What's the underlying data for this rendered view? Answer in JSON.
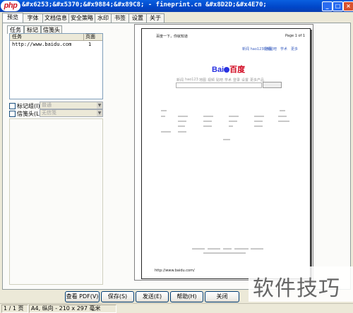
{
  "window": {
    "title": "&#x6253;&#x5370;&#x9884;&#x89C8; - fineprint.cn &#x8D2D;&#x4E70;",
    "logo_text": "php",
    "minimize": "_",
    "maximize": "□",
    "close": "×"
  },
  "tabs": [
    "预览",
    "字体",
    "文档信息",
    "安全策略",
    "水印",
    "书签",
    "设置",
    "关于"
  ],
  "subtabs": [
    "任务",
    "标记",
    "信笺头"
  ],
  "list": {
    "col_name": "任务",
    "col_page": "页面",
    "rows": [
      {
        "name": "http://www.baidu.com",
        "page": "1"
      }
    ]
  },
  "options": {
    "mark_label": "标记组(I)",
    "mark_value": "普通",
    "letterhead_label": "信笺头(L)",
    "letterhead_value": "无信笺"
  },
  "preview": {
    "header_left": "百度一下，你就知道",
    "header_right": "Page 1 of 1",
    "logo_a": "Bai",
    "logo_b": "百度",
    "footer_url": "http://www.baidu.com/",
    "top_links": [
      "新闻 hao123 地图",
      "视频",
      "贴吧",
      "学术",
      "更多"
    ],
    "nav_links": [
      "新闻",
      "hao123",
      "地图",
      "视频",
      "贴吧",
      "学术",
      "登录",
      "设置",
      "更多产品"
    ]
  },
  "buttons": {
    "view_pdf": "查看 PDF(V)",
    "save": "保存(S)",
    "send": "发送(E)",
    "help": "帮助(H)",
    "close": "关闭"
  },
  "status": {
    "pages": "1 / 1 页",
    "info": "A4, 纵向 - 210 x 297 毫米"
  },
  "watermark": "软件技巧"
}
